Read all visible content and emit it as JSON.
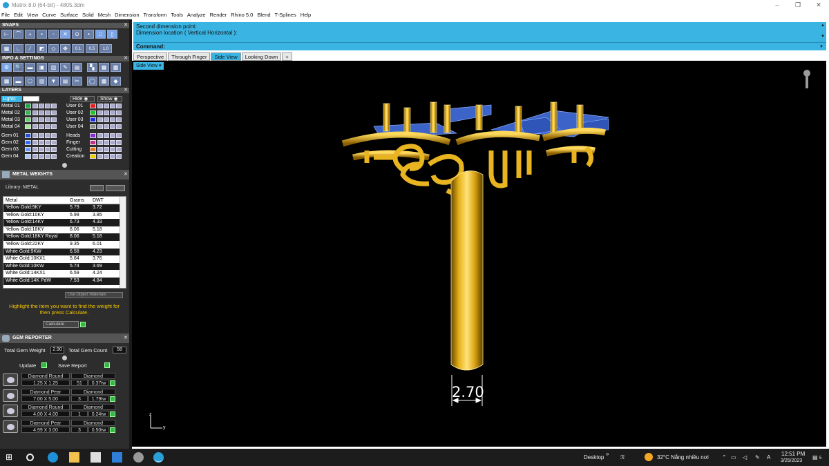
{
  "app": {
    "title": "Matrix 8.0 (64-bit) - 4805.3dm",
    "window_controls": [
      "–",
      "❐",
      "✕"
    ]
  },
  "menu": [
    "File",
    "Edit",
    "View",
    "Curve",
    "Surface",
    "Solid",
    "Mesh",
    "Dimension",
    "Transform",
    "Tools",
    "Analyze",
    "Render",
    "Rhino 5.0",
    "Blend",
    "T-Splines",
    "Help"
  ],
  "panels": {
    "snaps": {
      "title": "SNAPS",
      "values": [
        "0.1",
        "0.5",
        "1.0"
      ]
    },
    "info": {
      "title": "INFO & SETTINGS"
    },
    "layers": {
      "title": "LAYERS",
      "lights": "Lights",
      "hide": "Hide",
      "show": "Show",
      "left": [
        {
          "name": "Metal 01",
          "color": "#19a640"
        },
        {
          "name": "Metal 02",
          "color": "#2fb84f"
        },
        {
          "name": "Metal 03",
          "color": "#5fd06a"
        },
        {
          "name": "Metal 04",
          "color": "#9ee88e"
        },
        {
          "name": "Gem 01",
          "color": "#1d4fd8"
        },
        {
          "name": "Gem 02",
          "color": "#2d6bff"
        },
        {
          "name": "Gem 03",
          "color": "#6a9cff"
        },
        {
          "name": "Gem 04",
          "color": "#a9c6ff"
        }
      ],
      "right": [
        {
          "name": "User 01",
          "color": "#e81e1e"
        },
        {
          "name": "User 02",
          "color": "#22c32a"
        },
        {
          "name": "User 03",
          "color": "#1e2ee8"
        },
        {
          "name": "User 04",
          "color": "#8c8c8c"
        },
        {
          "name": "Heads",
          "color": "#8a2be2"
        },
        {
          "name": "Finger",
          "color": "#c62f8a"
        },
        {
          "name": "Cutting",
          "color": "#e8761e"
        },
        {
          "name": "Creation",
          "color": "#f0d000"
        }
      ]
    },
    "metal_weights": {
      "title": "METAL WEIGHTS",
      "library": "Library: METAL",
      "col_metal": "Metal",
      "col_grams": "Grams",
      "col_dwt": "DWT",
      "rows": [
        [
          "Yellow Gold:9KY",
          "5.79",
          "3.72"
        ],
        [
          "Yellow Gold:10KY",
          "5.99",
          "3.85"
        ],
        [
          "Yellow Gold:14KY",
          "6.73",
          "4.33"
        ],
        [
          "Yellow Gold:18KY",
          "8.06",
          "5.18"
        ],
        [
          "Yellow Gold:18KY Royal",
          "8.06",
          "5.18"
        ],
        [
          "Yellow Gold:22KY",
          "9.35",
          "6.01"
        ],
        [
          "White Gold:9KW",
          "6.58",
          "4.23"
        ],
        [
          "White Gold:10KX1",
          "5.84",
          "3.76"
        ],
        [
          "White Gold:10KW",
          "5.74",
          "3.69"
        ],
        [
          "White Gold:14KX1",
          "6.59",
          "4.24"
        ],
        [
          "White Gold:14K PdW",
          "7.53",
          "4.84"
        ]
      ],
      "use_object_materials": "Use Object Materials",
      "hint": "Highlight the item you want to find the weight for then press Calculate.",
      "calculate": "Calculate"
    },
    "gem_reporter": {
      "title": "GEM REPORTER",
      "total_weight_label": "Total Gem Weight",
      "total_weight": "2.90",
      "total_count_label": "Total Gem Count",
      "total_count": "58",
      "update": "Update",
      "save_report": "Save Report",
      "gems": [
        {
          "shape": "Diamond Round",
          "size": "1.25 X 1.25",
          "material": "Diamond",
          "count": "51",
          "weight": "0.37tw"
        },
        {
          "shape": "Diamond Pear",
          "size": "7.00 X 5.00",
          "material": "Diamond",
          "count": "3",
          "weight": "1.79tw"
        },
        {
          "shape": "Diamond Round",
          "size": "4.00 X 4.00",
          "material": "Diamond",
          "count": "1",
          "weight": "0.24tw"
        },
        {
          "shape": "Diamond Pear",
          "size": "4.99 X 3.00",
          "material": "Diamond",
          "count": "3",
          "weight": "0.50tw"
        }
      ]
    }
  },
  "command": {
    "line1": "Second dimension point:",
    "line2": "Dimension location ( Vertical  Horizontal ):",
    "prompt": "Command:"
  },
  "tabs": [
    "Perspective",
    "Through Finger",
    "Side View",
    "Looking Down",
    "+"
  ],
  "viewport": {
    "label": "Side View",
    "dimension": "2.70",
    "axis_z": "z",
    "axis_y": "y"
  },
  "taskbar": {
    "desktop": "Desktop",
    "weather": "32°C  Nắng nhiều nơi",
    "time": "12:51 PM",
    "date": "3/25/2023",
    "notif": "5"
  }
}
